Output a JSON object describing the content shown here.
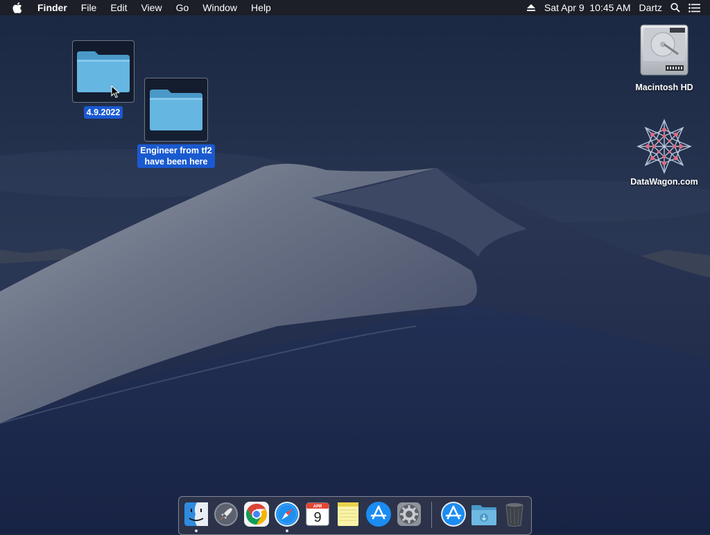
{
  "menubar": {
    "app_name": "Finder",
    "menus": [
      "File",
      "Edit",
      "View",
      "Go",
      "Window",
      "Help"
    ],
    "clock": "Sat Apr 9  10:45 AM",
    "user": "Dartz"
  },
  "desktop": {
    "icons": [
      {
        "label": "4.9.2022",
        "type": "folder",
        "selected": true
      },
      {
        "label_line1": "Engineer from tf2",
        "label_line2": "have been here",
        "type": "folder",
        "selected": true
      },
      {
        "label": "Macintosh HD",
        "type": "hard-drive",
        "selected": false
      },
      {
        "label": "DataWagon.com",
        "type": "star-logo",
        "selected": false
      }
    ]
  },
  "dock": {
    "apps": [
      {
        "name": "Finder",
        "icon": "finder-icon",
        "running": true
      },
      {
        "name": "Launchpad",
        "icon": "launchpad-icon",
        "running": false
      },
      {
        "name": "Google Chrome",
        "icon": "chrome-icon",
        "running": false
      },
      {
        "name": "Safari",
        "icon": "safari-icon",
        "running": true
      },
      {
        "name": "Calendar",
        "icon": "calendar-icon",
        "running": false,
        "month": "APR",
        "day": "9"
      },
      {
        "name": "Notes",
        "icon": "notes-icon",
        "running": false
      },
      {
        "name": "App Store",
        "icon": "app-store-icon",
        "running": false
      },
      {
        "name": "System Preferences",
        "icon": "gear-icon",
        "running": false
      }
    ],
    "stacks": [
      {
        "name": "Applications",
        "icon": "app-store-icon"
      },
      {
        "name": "Downloads",
        "icon": "downloads-folder-icon"
      },
      {
        "name": "Trash",
        "icon": "trash-icon"
      }
    ]
  },
  "colors": {
    "selection": "#1a5ad0",
    "folder_blue": "#5fb2df",
    "wallpaper_sky": "#1b2740"
  }
}
